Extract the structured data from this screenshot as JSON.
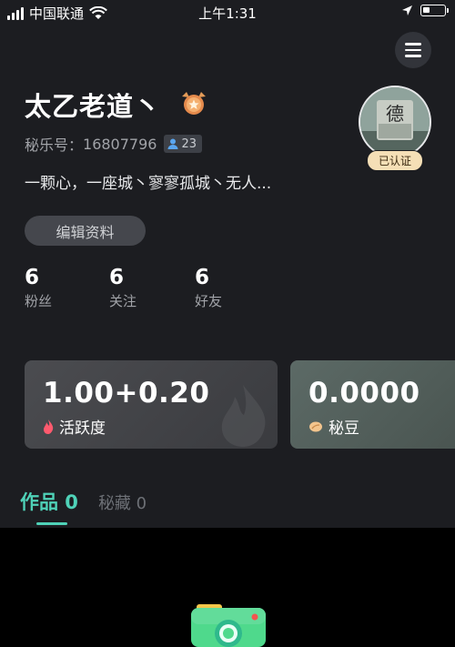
{
  "status_bar": {
    "carrier": "中国联通",
    "time": "上午1:31",
    "battery_level": 0.35
  },
  "profile": {
    "name": "太乙老道丶",
    "id_label": "秘乐号：",
    "id_value": "16807796",
    "badge_count": "23",
    "bio": "一颗心，一座城丶寥寥孤城丶无人...",
    "edit_button": "编辑资料",
    "avatar_glyph": "德",
    "verified_label": "已认证"
  },
  "stats": [
    {
      "num": "6",
      "label": "粉丝"
    },
    {
      "num": "6",
      "label": "关注"
    },
    {
      "num": "6",
      "label": "好友"
    }
  ],
  "cards": {
    "activity": {
      "value": "1.00+0.20",
      "label": "活跃度"
    },
    "beans": {
      "value": "0.0000",
      "label": "秘豆"
    }
  },
  "tabs": {
    "works": "作品 0",
    "hidden": "秘藏 0"
  },
  "colors": {
    "accent": "#4fd2b8",
    "background": "#1c1d21",
    "verified_bg": "#f5dfb6"
  },
  "icons": [
    "signal-icon",
    "wifi-icon",
    "location-arrow-icon",
    "battery-icon",
    "menu-icon",
    "medal-icon",
    "user-icon",
    "flame-icon",
    "bean-icon",
    "camera-icon"
  ]
}
